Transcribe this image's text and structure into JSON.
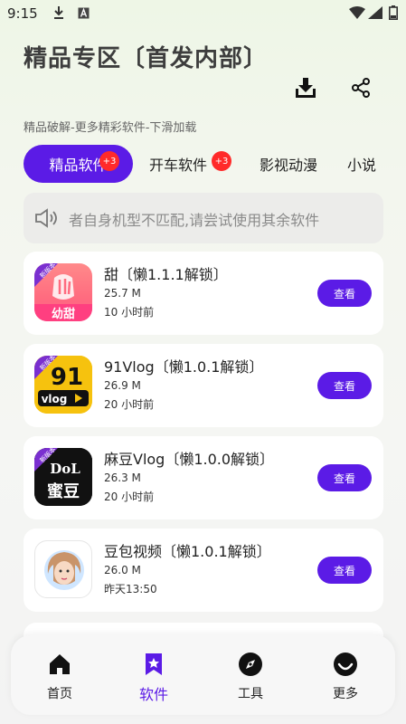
{
  "status_bar": {
    "time": "9:15"
  },
  "header": {
    "title": "精品专区〔首发内部〕",
    "subtitle": "精品破解-更多精彩软件-下滑加载"
  },
  "tabs": [
    {
      "label": "精品软件",
      "badge": "+3",
      "active": true
    },
    {
      "label": "开车软件",
      "badge": "+3",
      "active": false
    },
    {
      "label": "影视动漫",
      "badge": "",
      "active": false
    },
    {
      "label": "小说",
      "badge": "",
      "active": false
    }
  ],
  "notice": {
    "text": "者自身机型不匹配,请尝试使用其余软件"
  },
  "apps": [
    {
      "name": "甜〔懒1.1.1解锁〕",
      "size": "25.7 M",
      "time": "10 小时前",
      "button": "查看",
      "icon": "sweet-app-icon",
      "icon_text": "幼甜",
      "ribbon": "新版本"
    },
    {
      "name": "91Vlog〔懒1.0.1解锁〕",
      "size": "26.9 M",
      "time": "20 小时前",
      "button": "查看",
      "icon": "vlog91-app-icon",
      "icon_text": "vlog",
      "ribbon": "新版本"
    },
    {
      "name": "麻豆Vlog〔懒1.0.0解锁〕",
      "size": "26.3 M",
      "time": "20 小时前",
      "button": "查看",
      "icon": "madou-app-icon",
      "icon_text": "蜜豆",
      "ribbon": "新版本"
    },
    {
      "name": "豆包视频〔懒1.0.1解锁〕",
      "size": "26.0 M",
      "time": "昨天13:50",
      "button": "查看",
      "icon": "doubao-app-icon"
    }
  ],
  "bottom_nav": [
    {
      "label": "首页",
      "icon": "home-icon",
      "active": false
    },
    {
      "label": "软件",
      "icon": "bookmark-star-icon",
      "active": true
    },
    {
      "label": "工具",
      "icon": "compass-icon",
      "active": false
    },
    {
      "label": "更多",
      "icon": "smile-icon",
      "active": false
    }
  ],
  "colors": {
    "accent": "#5b1be6",
    "badge": "#ff2a2a"
  }
}
